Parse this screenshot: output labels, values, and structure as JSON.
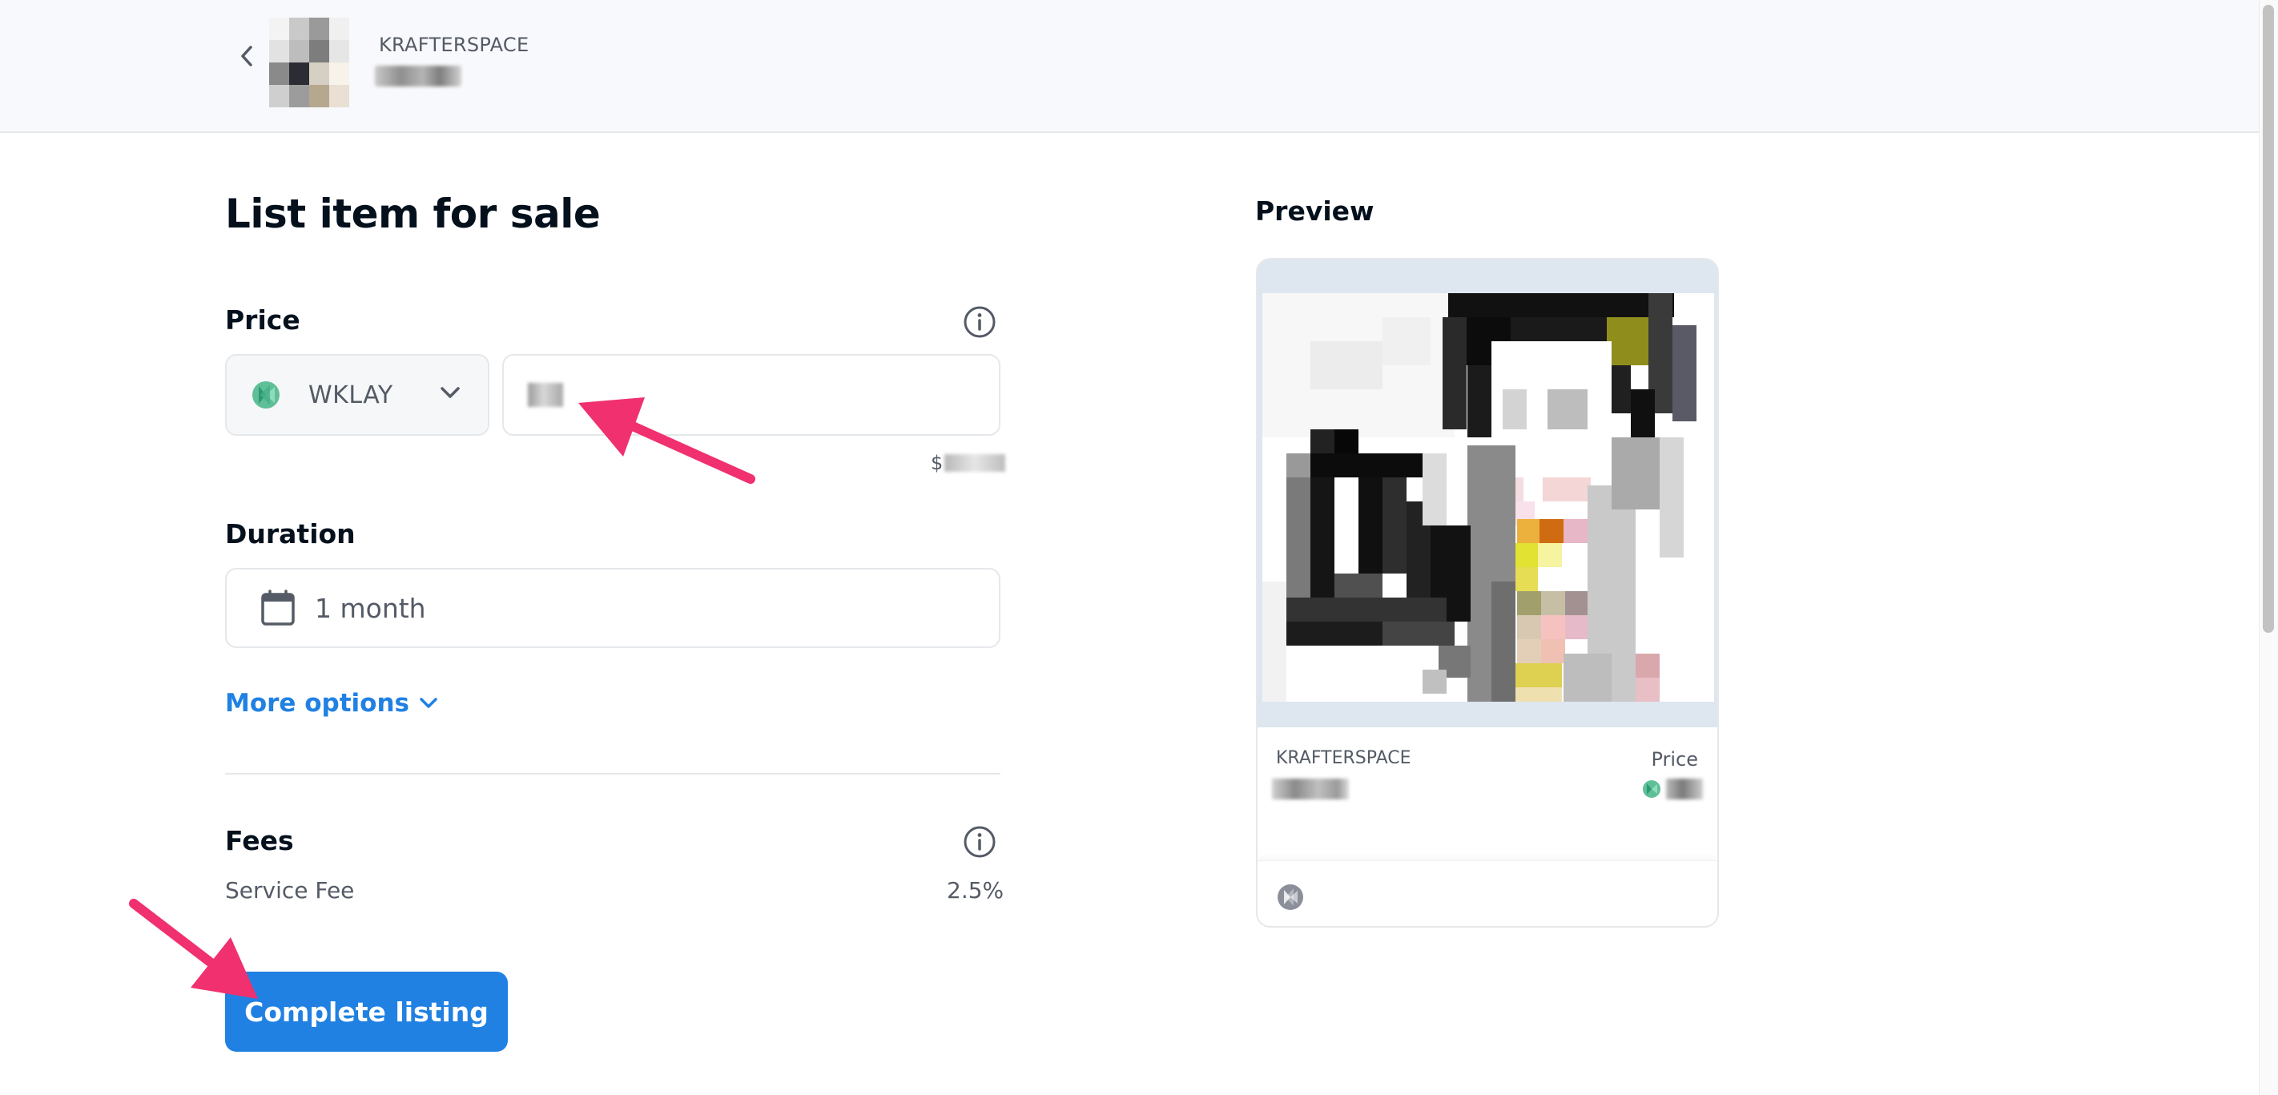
{
  "header": {
    "collection_name": "KRAFTERSPACE",
    "back_icon": "chevron-left-icon"
  },
  "form": {
    "title": "List item for sale",
    "price": {
      "label": "Price",
      "currency": "WKLAY",
      "currency_icon": "klaytn-icon",
      "usd_prefix": "$"
    },
    "duration": {
      "label": "Duration",
      "value": "1 month",
      "icon": "calendar-icon"
    },
    "more_options": "More options",
    "fees": {
      "label": "Fees",
      "service_fee_label": "Service Fee",
      "service_fee_value": "2.5%"
    },
    "submit_label": "Complete listing"
  },
  "preview": {
    "title": "Preview",
    "collection_name": "KRAFTERSPACE",
    "price_label": "Price",
    "chain_icon": "klaytn-icon"
  },
  "colors": {
    "accent": "#2081e2",
    "arrow": "#f0306f",
    "text_primary": "#04111d",
    "text_secondary": "#545b66",
    "border": "#e5e8eb"
  }
}
